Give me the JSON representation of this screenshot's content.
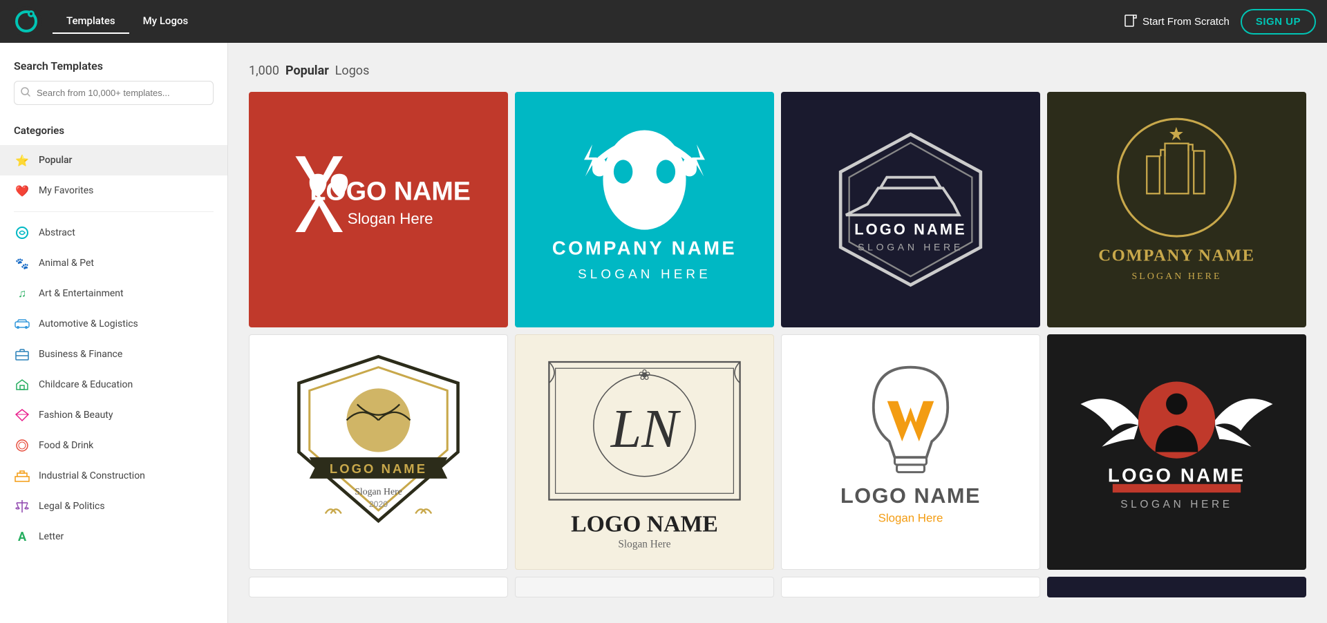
{
  "header": {
    "logo_alt": "Logo Maker",
    "nav": [
      {
        "label": "Templates",
        "active": true
      },
      {
        "label": "My Logos",
        "active": false
      }
    ],
    "start_scratch_label": "Start From Scratch",
    "signup_label": "SIGN UP"
  },
  "sidebar": {
    "search_title": "Search Templates",
    "search_placeholder": "Search from 10,000+ templates...",
    "categories_title": "Categories",
    "special_items": [
      {
        "label": "Popular",
        "icon": "⭐",
        "icon_color": "#e74c3c",
        "active": true
      },
      {
        "label": "My Favorites",
        "icon": "❤️",
        "icon_color": "#e74c3c",
        "active": false
      }
    ],
    "items": [
      {
        "label": "Abstract",
        "icon": "🌀",
        "color": "#00b8c4"
      },
      {
        "label": "Animal & Pet",
        "icon": "🐾",
        "color": "#e67e22"
      },
      {
        "label": "Art & Entertainment",
        "icon": "🎵",
        "color": "#27ae60"
      },
      {
        "label": "Automotive & Logistics",
        "icon": "🚗",
        "color": "#3498db"
      },
      {
        "label": "Business & Finance",
        "icon": "💼",
        "color": "#2980b9"
      },
      {
        "label": "Childcare & Education",
        "icon": "🏠",
        "color": "#27ae60"
      },
      {
        "label": "Fashion & Beauty",
        "icon": "💎",
        "color": "#e91e8c"
      },
      {
        "label": "Food & Drink",
        "icon": "🍽️",
        "color": "#e74c3c"
      },
      {
        "label": "Industrial & Construction",
        "icon": "🏗️",
        "color": "#f39c12"
      },
      {
        "label": "Legal & Politics",
        "icon": "⚖️",
        "color": "#8e44ad"
      },
      {
        "label": "Letter",
        "icon": "A",
        "color": "#27ae60"
      }
    ]
  },
  "content": {
    "count": "1,000",
    "category_bold": "Popular",
    "category_suffix": "Logos"
  }
}
